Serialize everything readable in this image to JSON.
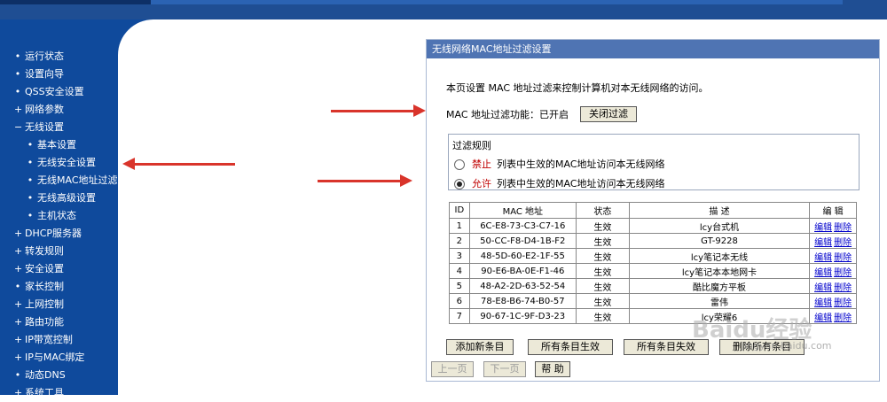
{
  "sidebar": {
    "items": [
      {
        "marker": "•",
        "label": "运行状态",
        "level": 1
      },
      {
        "marker": "•",
        "label": "设置向导",
        "level": 1
      },
      {
        "marker": "•",
        "label": "QSS安全设置",
        "level": 1
      },
      {
        "marker": "+",
        "label": "网络参数",
        "level": 1
      },
      {
        "marker": "−",
        "label": "无线设置",
        "level": 1
      },
      {
        "marker": "•",
        "label": "基本设置",
        "level": 2
      },
      {
        "marker": "•",
        "label": "无线安全设置",
        "level": 2
      },
      {
        "marker": "•",
        "label": "无线MAC地址过滤",
        "level": 2
      },
      {
        "marker": "•",
        "label": "无线高级设置",
        "level": 2
      },
      {
        "marker": "•",
        "label": "主机状态",
        "level": 2
      },
      {
        "marker": "+",
        "label": "DHCP服务器",
        "level": 1
      },
      {
        "marker": "+",
        "label": "转发规则",
        "level": 1
      },
      {
        "marker": "+",
        "label": "安全设置",
        "level": 1
      },
      {
        "marker": "•",
        "label": "家长控制",
        "level": 1
      },
      {
        "marker": "+",
        "label": "上网控制",
        "level": 1
      },
      {
        "marker": "+",
        "label": "路由功能",
        "level": 1
      },
      {
        "marker": "+",
        "label": "IP带宽控制",
        "level": 1
      },
      {
        "marker": "+",
        "label": "IP与MAC绑定",
        "level": 1
      },
      {
        "marker": "•",
        "label": "动态DNS",
        "level": 1
      },
      {
        "marker": "+",
        "label": "系统工具",
        "level": 1
      }
    ]
  },
  "panel": {
    "title": "无线网络MAC地址过滤设置",
    "description": "本页设置 MAC 地址过滤来控制计算机对本无线网络的访问。",
    "filter_status_label": "MAC 地址过滤功能：已开启",
    "toggle_button": "关闭过滤",
    "rules": {
      "legend": "过滤规则",
      "deny_keyword": "禁止",
      "deny_text": "列表中生效的MAC地址访问本无线网络",
      "allow_keyword": "允许",
      "allow_text": "列表中生效的MAC地址访问本无线网络",
      "selected": "allow"
    },
    "table": {
      "headers": [
        "ID",
        "MAC 地址",
        "状态",
        "描 述",
        "编 辑"
      ],
      "rows": [
        {
          "id": "1",
          "mac": "6C-E8-73-C3-C7-16",
          "status": "生效",
          "desc": "lcy台式机"
        },
        {
          "id": "2",
          "mac": "50-CC-F8-D4-1B-F2",
          "status": "生效",
          "desc": "GT-9228"
        },
        {
          "id": "3",
          "mac": "48-5D-60-E2-1F-55",
          "status": "生效",
          "desc": "lcy笔记本无线"
        },
        {
          "id": "4",
          "mac": "90-E6-BA-0E-F1-46",
          "status": "生效",
          "desc": "lcy笔记本本地网卡"
        },
        {
          "id": "5",
          "mac": "48-A2-2D-63-52-54",
          "status": "生效",
          "desc": "酷比魔方平板"
        },
        {
          "id": "6",
          "mac": "78-E8-B6-74-B0-57",
          "status": "生效",
          "desc": "雷伟"
        },
        {
          "id": "7",
          "mac": "90-67-1C-9F-D3-23",
          "status": "生效",
          "desc": "lcy荣耀6"
        }
      ],
      "edit_label": "编辑",
      "delete_label": "删除"
    },
    "buttons": {
      "add": "添加新条目",
      "enable_all": "所有条目生效",
      "disable_all": "所有条目失效",
      "delete_all": "删除所有条目",
      "prev": "上一页",
      "next": "下一页",
      "help": "帮 助"
    }
  },
  "watermark": {
    "text": "Baidu经验",
    "url": "jingyan.baidu.com"
  },
  "colors": {
    "sidebar": "#0f4a9c",
    "title_bar": "#4f74b3",
    "arrow": "#d9342b",
    "link": "#0000cc"
  }
}
